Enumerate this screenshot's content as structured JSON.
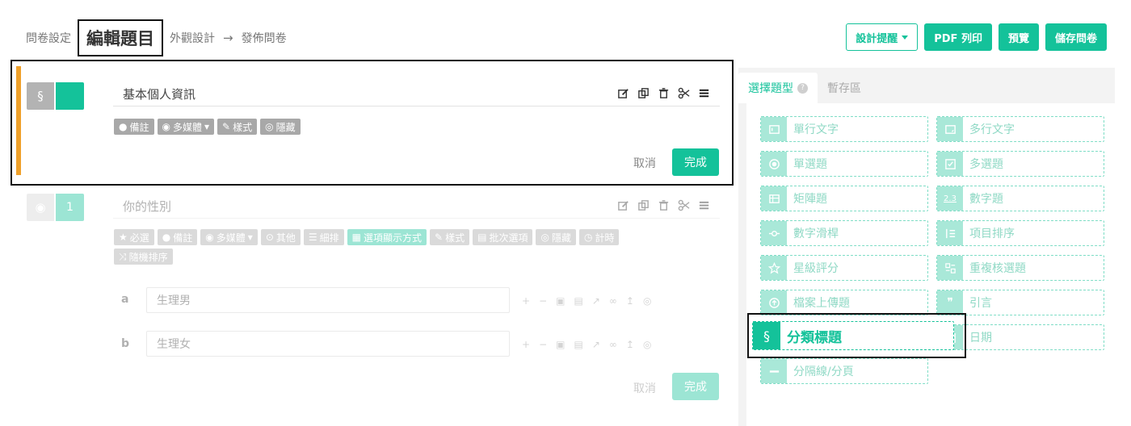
{
  "breadcrumb": {
    "step1": "問卷設定",
    "current": "編輯題目",
    "step3": "外觀設計",
    "arrow": "→",
    "step4": "發佈問卷"
  },
  "top_buttons": {
    "design_tip": "設計提醒",
    "pdf": "PDF 列印",
    "preview": "預覽",
    "save": "儲存問卷"
  },
  "question1": {
    "badge_symbol": "§",
    "title": "基本個人資訊",
    "tags": [
      "備註",
      "多媒體",
      "樣式",
      "隱藏"
    ],
    "cancel": "取消",
    "done": "完成"
  },
  "question2": {
    "badge_number": "1",
    "title": "你的性別",
    "tags_row1": [
      "必選",
      "備註",
      "多媒體",
      "其他",
      "細排",
      "選項顯示方式",
      "樣式",
      "批次選項",
      "隱藏",
      "計時"
    ],
    "tags_row2": [
      "隨機排序"
    ],
    "options": [
      {
        "letter": "a",
        "value": "生理男"
      },
      {
        "letter": "b",
        "value": "生理女"
      }
    ],
    "cancel": "取消",
    "done": "完成"
  },
  "panel": {
    "tab_active": "選擇題型",
    "help": "?",
    "tab_inactive": "暫存區",
    "tiles": [
      {
        "label": "單行文字",
        "icon": "single-line-icon"
      },
      {
        "label": "多行文字",
        "icon": "multi-line-icon"
      },
      {
        "label": "單選題",
        "icon": "radio-icon"
      },
      {
        "label": "多選題",
        "icon": "checkbox-icon"
      },
      {
        "label": "矩陣題",
        "icon": "matrix-icon"
      },
      {
        "label": "數字題",
        "icon": "number-icon",
        "glyph": "2.3"
      },
      {
        "label": "數字滑桿",
        "icon": "slider-icon"
      },
      {
        "label": "項目排序",
        "icon": "sort-icon"
      },
      {
        "label": "星級評分",
        "icon": "star-icon"
      },
      {
        "label": "重複核選題",
        "icon": "repeat-check-icon"
      },
      {
        "label": "檔案上傳題",
        "icon": "upload-icon"
      },
      {
        "label": "引言",
        "icon": "quote-icon",
        "glyph": "❞"
      },
      {
        "label": "分類標題",
        "icon": "section-icon",
        "glyph": "§"
      },
      {
        "label": "日期",
        "icon": "date-icon"
      },
      {
        "label": "分隔線/分頁",
        "icon": "divider-icon"
      }
    ]
  },
  "colors": {
    "accent": "#14c29a",
    "accent_light": "#a9e8d8",
    "question_bar": "#f0a12b"
  }
}
